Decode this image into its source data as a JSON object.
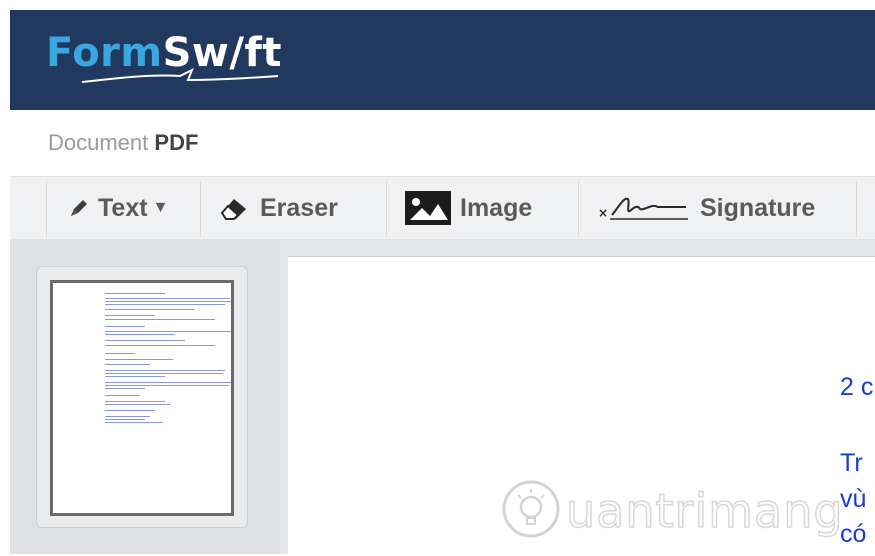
{
  "app": {
    "logo_left": "Form",
    "logo_right": "Sw",
    "logo_i": "/",
    "logo_end": "ft"
  },
  "document": {
    "label": "Document",
    "type": "PDF"
  },
  "toolbar": {
    "text_label": "Text",
    "eraser_label": "Eraser",
    "image_label": "Image",
    "signature_label": "Signature"
  },
  "page_text": {
    "line1": "2 c",
    "line2": "Tr",
    "line3": "vù",
    "line4": "có"
  },
  "watermark": {
    "text": "uantrimang"
  },
  "colors": {
    "header_bg": "#21395e",
    "logo_accent": "#3aa8e0",
    "doc_text": "#1a3ad6"
  }
}
